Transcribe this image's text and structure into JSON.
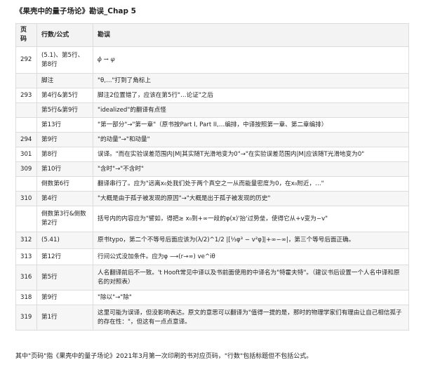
{
  "title": "《果壳中的量子场论》勘误_Chap 5",
  "table": {
    "headers": [
      "页码",
      "行数/公式",
      "勘误"
    ],
    "rows": [
      {
        "page": "292",
        "line": "(5.1)、第5行、第8行",
        "text": "ϕ → φ"
      },
      {
        "page": "",
        "line": "脚注",
        "text": "\"θ,…\"打到了角标上"
      },
      {
        "page": "293",
        "line": "第4行&第5行",
        "text": "脚注2位置错了，应该在第5行\"…论证\"之后"
      },
      {
        "page": "",
        "line": "第5行&第9行",
        "text": "\"idealized\"的翻译有点怪"
      },
      {
        "page": "",
        "line": "第13行",
        "text": "\"第一部分\"→\"第一章\"（原书按Part I, Part II,…编排，中译按照第一章、第二章编排）"
      },
      {
        "page": "294",
        "line": "第9行",
        "text": "\"的动量\"→\"和动量\""
      },
      {
        "page": "301",
        "line": "第8行",
        "text": "误译。\"而在实验误差范围内|M|其实随T光滑地变为0\"→\"在实验误差范围内|M|应该随T光滑地变为0\""
      },
      {
        "page": "309",
        "line": "第10行",
        "text": "\"含时\"→\"不含时\""
      },
      {
        "page": "",
        "line": "倒数第6行",
        "text": "翻译串行了。应为\"远离x₀处我们处于两个真空之一从而能量密度为0，在x₀附近，…\""
      },
      {
        "page": "310",
        "line": "第4行",
        "text": "\"大概是由于孤子被发现的原因\"→\"大概是出于孤子被发现的历史\""
      },
      {
        "page": "",
        "line": "倒数第3行&倒数第2行",
        "text": "括号内的内容应为\"譬如，得把≳ x₀到+∞一段的φ(x)'抬'过势垒，使得它从+v变为−v\""
      },
      {
        "page": "312",
        "line": "(5.41)",
        "text": "原书typo，第二个不等号后面应该为(λ/2)^1/2 |[⅓φ³ − v²φ]|+∞−∞|，第三个等号后面正确。"
      },
      {
        "page": "313",
        "line": "第12行",
        "text": "行间公式没加条件。应为φ ⟶(r→∞) ve^iθ"
      },
      {
        "page": "316",
        "line": "第5行",
        "text": "人名翻译前后不一致。't Hooft常见中译以及书前面使用的中译名为\"特霍夫特\"。（建议书后设置一个人名中译和原名的对照表）"
      },
      {
        "page": "318",
        "line": "第9行",
        "text": "\"除以\"→\"除\""
      },
      {
        "page": "319",
        "line": "第1行",
        "text": "这里可能为误译，但没影响表达。原文的意思可以翻译为\"值得一提的是，那时的物理学家们有理由让自己相信孤子的存在性：\"，但这有一点点意译。"
      }
    ]
  },
  "footer": "其中\"页码\"指《果壳中的量子场论》2021年3月第一次印刷的书对应页码，\"行数\"包括标题但不包括公式。"
}
